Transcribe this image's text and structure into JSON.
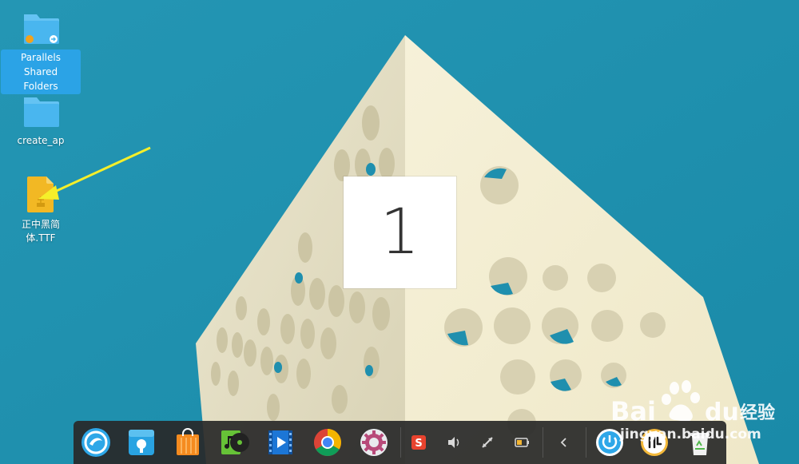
{
  "desktop": {
    "icons": [
      {
        "label": "Parallels Shared\nFolders",
        "selected": true
      },
      {
        "label": "create_ap",
        "selected": false
      },
      {
        "label": "正中黑简\n体.TTF",
        "selected": false
      }
    ]
  },
  "workspace": {
    "number": "1"
  },
  "dock": {
    "apps": [
      "launcher-icon",
      "app-store-icon",
      "store-bag-icon",
      "music-player-icon",
      "video-player-icon",
      "chrome-icon",
      "settings-icon"
    ],
    "tray": [
      "sogou-input-icon",
      "volume-icon",
      "network-icon",
      "battery-icon",
      "collapse-arrow-icon"
    ],
    "right": [
      "power-icon",
      "clock-icon",
      "trash-icon"
    ]
  },
  "watermark": {
    "text": "jingyan.baidu.com"
  },
  "colors": {
    "sky": "#1f8fae",
    "selection": "#2ba3e6",
    "dock": "#282828",
    "arrow": "#f5ef2a"
  }
}
